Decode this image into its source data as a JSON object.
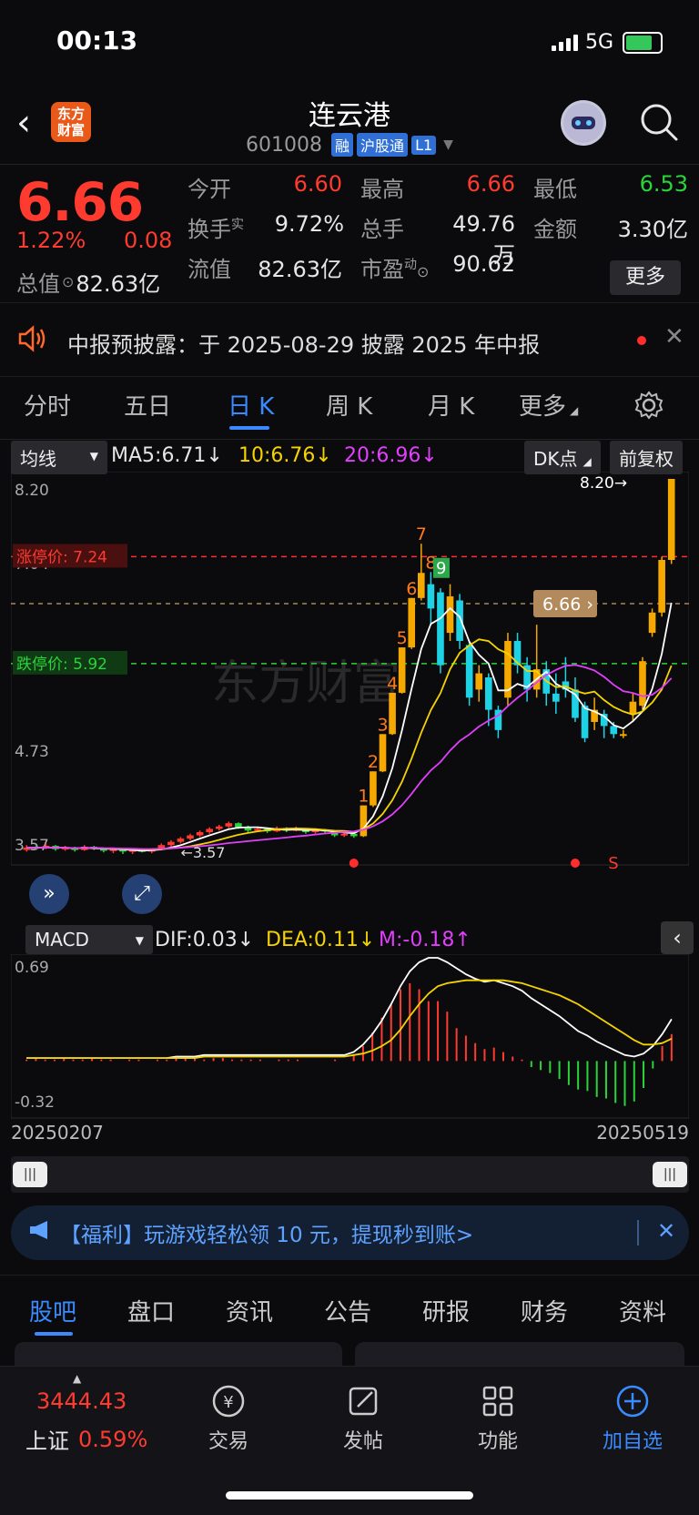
{
  "status_bar": {
    "time": "00:13",
    "network": "5G"
  },
  "header": {
    "logo_text": "东方财富",
    "title": "连云港",
    "code": "601008",
    "tags": [
      "融",
      "沪股通",
      "L1"
    ]
  },
  "quote": {
    "price": "6.66",
    "change_pct": "1.22%",
    "change_amt": "0.08",
    "rows": [
      [
        {
          "label": "今开",
          "value": "6.60",
          "color": "red"
        },
        {
          "label": "最高",
          "value": "6.66",
          "color": "red"
        },
        {
          "label": "最低",
          "value": "6.53",
          "color": "green"
        }
      ],
      [
        {
          "label": "换手",
          "sup": "实",
          "value": "9.72%",
          "color": "white"
        },
        {
          "label": "总手",
          "value": "49.76万",
          "color": "white"
        },
        {
          "label": "金额",
          "value": "3.30亿",
          "color": "white"
        }
      ],
      [
        {
          "label": "流值",
          "value": "82.63亿",
          "color": "white"
        },
        {
          "label": "市盈",
          "sup": "动",
          "value": "90.62",
          "color": "white"
        }
      ]
    ],
    "total_value_label": "总值",
    "total_value": "82.63亿",
    "more_label": "更多"
  },
  "notice": {
    "text": "中报预披露：于 2025-08-29 披露 2025 年中报"
  },
  "tabs": [
    "分时",
    "五日",
    "日 K",
    "周 K",
    "月 K",
    "更多"
  ],
  "active_tab": 2,
  "ma": {
    "dropdown": "均线",
    "ma5": "MA5:6.71",
    "ma10": "10:6.76",
    "ma20": "20:6.96",
    "dk_label": "DK点",
    "adjust_label": "前复权"
  },
  "macd": {
    "dropdown": "MACD",
    "dif": "DIF:0.03",
    "dea": "DEA:0.11",
    "m": "M:-0.18"
  },
  "colors": {
    "up": "#ff3b30",
    "down": "#2ad43a",
    "accent": "#3a8bff",
    "ma5": "#ffffff",
    "ma10": "#f5d300",
    "ma20": "#e040fb"
  },
  "chart_data": [
    {
      "type": "candlestick",
      "ylim": [
        3.57,
        8.2
      ],
      "y_ticks": [
        "8.20",
        "7.04",
        "5.89",
        "4.73",
        "3.57"
      ],
      "limit_up_label": "涨停价:",
      "limit_up": "7.24",
      "limit_down_label": "跌停价:",
      "limit_down": "5.92",
      "current_label": "6.66",
      "high_label": "8.20",
      "low_label": "3.57",
      "signal_labels": [
        "1",
        "2",
        "3",
        "4",
        "5",
        "6",
        "7",
        "8",
        "9",
        "S"
      ],
      "watermark": "东方财富",
      "candles": [
        {
          "o": 3.62,
          "c": 3.65,
          "h": 3.68,
          "l": 3.6
        },
        {
          "o": 3.66,
          "c": 3.64,
          "h": 3.68,
          "l": 3.62
        },
        {
          "o": 3.64,
          "c": 3.67,
          "h": 3.7,
          "l": 3.63
        },
        {
          "o": 3.67,
          "c": 3.63,
          "h": 3.68,
          "l": 3.61
        },
        {
          "o": 3.63,
          "c": 3.65,
          "h": 3.67,
          "l": 3.61
        },
        {
          "o": 3.65,
          "c": 3.62,
          "h": 3.66,
          "l": 3.6
        },
        {
          "o": 3.62,
          "c": 3.66,
          "h": 3.68,
          "l": 3.61
        },
        {
          "o": 3.66,
          "c": 3.64,
          "h": 3.67,
          "l": 3.62
        },
        {
          "o": 3.64,
          "c": 3.61,
          "h": 3.65,
          "l": 3.59
        },
        {
          "o": 3.61,
          "c": 3.63,
          "h": 3.65,
          "l": 3.58
        },
        {
          "o": 3.63,
          "c": 3.6,
          "h": 3.64,
          "l": 3.57
        },
        {
          "o": 3.6,
          "c": 3.62,
          "h": 3.63,
          "l": 3.57
        },
        {
          "o": 3.62,
          "c": 3.6,
          "h": 3.64,
          "l": 3.59
        },
        {
          "o": 3.6,
          "c": 3.63,
          "h": 3.64,
          "l": 3.58
        },
        {
          "o": 3.63,
          "c": 3.68,
          "h": 3.7,
          "l": 3.62
        },
        {
          "o": 3.68,
          "c": 3.72,
          "h": 3.74,
          "l": 3.66
        },
        {
          "o": 3.72,
          "c": 3.76,
          "h": 3.78,
          "l": 3.7
        },
        {
          "o": 3.76,
          "c": 3.8,
          "h": 3.82,
          "l": 3.74
        },
        {
          "o": 3.8,
          "c": 3.84,
          "h": 3.86,
          "l": 3.78
        },
        {
          "o": 3.84,
          "c": 3.88,
          "h": 3.9,
          "l": 3.82
        },
        {
          "o": 3.88,
          "c": 3.91,
          "h": 3.93,
          "l": 3.86
        },
        {
          "o": 3.91,
          "c": 3.95,
          "h": 3.97,
          "l": 3.89
        },
        {
          "o": 3.95,
          "c": 3.9,
          "h": 3.96,
          "l": 3.88
        },
        {
          "o": 3.9,
          "c": 3.86,
          "h": 3.92,
          "l": 3.84
        },
        {
          "o": 3.86,
          "c": 3.88,
          "h": 3.9,
          "l": 3.84
        },
        {
          "o": 3.88,
          "c": 3.85,
          "h": 3.89,
          "l": 3.83
        },
        {
          "o": 3.85,
          "c": 3.89,
          "h": 3.91,
          "l": 3.84
        },
        {
          "o": 3.89,
          "c": 3.86,
          "h": 3.9,
          "l": 3.84
        },
        {
          "o": 3.86,
          "c": 3.88,
          "h": 3.91,
          "l": 3.85
        },
        {
          "o": 3.88,
          "c": 3.84,
          "h": 3.89,
          "l": 3.82
        },
        {
          "o": 3.84,
          "c": 3.87,
          "h": 3.89,
          "l": 3.82
        },
        {
          "o": 3.87,
          "c": 3.85,
          "h": 3.88,
          "l": 3.83
        },
        {
          "o": 3.85,
          "c": 3.8,
          "h": 3.86,
          "l": 3.78
        },
        {
          "o": 3.8,
          "c": 3.82,
          "h": 3.84,
          "l": 3.78
        },
        {
          "o": 3.82,
          "c": 3.79,
          "h": 3.83,
          "l": 3.77
        },
        {
          "o": 3.79,
          "c": 4.17,
          "h": 4.17,
          "l": 3.78
        },
        {
          "o": 4.17,
          "c": 4.59,
          "h": 4.59,
          "l": 4.15
        },
        {
          "o": 4.59,
          "c": 5.05,
          "h": 5.05,
          "l": 4.58
        },
        {
          "o": 5.05,
          "c": 5.56,
          "h": 5.56,
          "l": 5.04
        },
        {
          "o": 5.56,
          "c": 6.12,
          "h": 6.12,
          "l": 5.55
        },
        {
          "o": 6.12,
          "c": 6.73,
          "h": 6.73,
          "l": 6.1
        },
        {
          "o": 6.73,
          "c": 7.04,
          "h": 7.4,
          "l": 6.7
        },
        {
          "o": 6.9,
          "c": 6.6,
          "h": 7.05,
          "l": 6.4
        },
        {
          "o": 6.8,
          "c": 5.9,
          "h": 6.85,
          "l": 5.8
        },
        {
          "o": 6.3,
          "c": 6.75,
          "h": 6.9,
          "l": 6.2
        },
        {
          "o": 6.7,
          "c": 6.2,
          "h": 6.78,
          "l": 6.1
        },
        {
          "o": 6.15,
          "c": 5.5,
          "h": 6.2,
          "l": 5.4
        },
        {
          "o": 5.6,
          "c": 5.8,
          "h": 5.9,
          "l": 5.45
        },
        {
          "o": 5.75,
          "c": 5.35,
          "h": 5.8,
          "l": 5.15
        },
        {
          "o": 5.35,
          "c": 5.1,
          "h": 5.4,
          "l": 5.0
        },
        {
          "o": 5.5,
          "c": 6.2,
          "h": 6.3,
          "l": 5.4
        },
        {
          "o": 6.2,
          "c": 5.9,
          "h": 6.3,
          "l": 5.8
        },
        {
          "o": 5.9,
          "c": 5.6,
          "h": 6.0,
          "l": 5.45
        },
        {
          "o": 5.6,
          "c": 5.85,
          "h": 6.4,
          "l": 5.5
        },
        {
          "o": 5.85,
          "c": 5.55,
          "h": 5.95,
          "l": 5.4
        },
        {
          "o": 5.55,
          "c": 5.45,
          "h": 5.8,
          "l": 5.3
        },
        {
          "o": 5.7,
          "c": 5.6,
          "h": 6.0,
          "l": 5.5
        },
        {
          "o": 5.6,
          "c": 5.25,
          "h": 5.75,
          "l": 5.2
        },
        {
          "o": 5.4,
          "c": 5.0,
          "h": 5.45,
          "l": 4.95
        },
        {
          "o": 5.2,
          "c": 5.35,
          "h": 5.5,
          "l": 5.1
        },
        {
          "o": 5.3,
          "c": 5.15,
          "h": 5.35,
          "l": 5.0
        },
        {
          "o": 5.15,
          "c": 5.05,
          "h": 5.2,
          "l": 5.0
        },
        {
          "o": 5.05,
          "c": 5.05,
          "h": 5.1,
          "l": 5.0
        },
        {
          "o": 5.3,
          "c": 5.45,
          "h": 5.55,
          "l": 5.2
        },
        {
          "o": 5.4,
          "c": 5.95,
          "h": 6.0,
          "l": 5.35
        },
        {
          "o": 6.3,
          "c": 6.55,
          "h": 6.6,
          "l": 6.25
        },
        {
          "o": 6.55,
          "c": 7.2,
          "h": 7.24,
          "l": 6.5
        },
        {
          "o": 7.2,
          "c": 8.2,
          "h": 8.2,
          "l": 7.15
        }
      ]
    },
    {
      "type": "macd",
      "ylim": [
        -0.32,
        0.69
      ],
      "y_ticks": [
        "0.69",
        "-0.32"
      ],
      "x_range": [
        "20250207",
        "20250519"
      ],
      "histogram": [
        0.01,
        0.02,
        0.01,
        0.01,
        0.02,
        0.01,
        0.01,
        0.02,
        0.01,
        0.01,
        0.0,
        0.01,
        0.01,
        0.0,
        0.01,
        0.01,
        0.02,
        0.02,
        0.02,
        0.01,
        0.02,
        0.02,
        0.01,
        0.01,
        0.01,
        0.01,
        0.0,
        0.01,
        0.01,
        0.01,
        0.0,
        0.0,
        0.0,
        0.01,
        0.0,
        0.04,
        0.1,
        0.19,
        0.29,
        0.38,
        0.48,
        0.52,
        0.48,
        0.4,
        0.4,
        0.33,
        0.22,
        0.17,
        0.12,
        0.08,
        0.09,
        0.06,
        0.03,
        0.01,
        -0.04,
        -0.06,
        -0.08,
        -0.12,
        -0.16,
        -0.19,
        -0.2,
        -0.24,
        -0.25,
        -0.28,
        -0.3,
        -0.27,
        -0.18,
        -0.05,
        0.1,
        0.18
      ],
      "dif": [
        0.02,
        0.02,
        0.02,
        0.02,
        0.02,
        0.02,
        0.02,
        0.02,
        0.02,
        0.02,
        0.02,
        0.02,
        0.02,
        0.02,
        0.02,
        0.02,
        0.03,
        0.03,
        0.03,
        0.04,
        0.04,
        0.04,
        0.04,
        0.04,
        0.04,
        0.04,
        0.04,
        0.04,
        0.04,
        0.04,
        0.04,
        0.04,
        0.04,
        0.04,
        0.04,
        0.06,
        0.11,
        0.18,
        0.27,
        0.38,
        0.5,
        0.6,
        0.66,
        0.69,
        0.69,
        0.66,
        0.62,
        0.58,
        0.55,
        0.53,
        0.54,
        0.52,
        0.5,
        0.47,
        0.42,
        0.38,
        0.34,
        0.3,
        0.25,
        0.2,
        0.17,
        0.13,
        0.1,
        0.07,
        0.04,
        0.03,
        0.05,
        0.1,
        0.18,
        0.28
      ],
      "dea": [
        0.02,
        0.02,
        0.02,
        0.02,
        0.02,
        0.02,
        0.02,
        0.02,
        0.02,
        0.02,
        0.02,
        0.02,
        0.02,
        0.02,
        0.02,
        0.02,
        0.02,
        0.02,
        0.02,
        0.03,
        0.03,
        0.03,
        0.03,
        0.03,
        0.03,
        0.03,
        0.03,
        0.03,
        0.03,
        0.03,
        0.03,
        0.03,
        0.03,
        0.03,
        0.03,
        0.04,
        0.05,
        0.07,
        0.1,
        0.14,
        0.21,
        0.3,
        0.38,
        0.45,
        0.5,
        0.52,
        0.53,
        0.54,
        0.54,
        0.54,
        0.54,
        0.54,
        0.53,
        0.52,
        0.5,
        0.48,
        0.46,
        0.44,
        0.41,
        0.38,
        0.34,
        0.3,
        0.26,
        0.22,
        0.18,
        0.14,
        0.11,
        0.11,
        0.12,
        0.15
      ]
    }
  ],
  "ad": {
    "text": "【福利】玩游戏轻松领 10 元，提现秒到账>"
  },
  "bottom_tabs": [
    "股吧",
    "盘口",
    "资讯",
    "公告",
    "研报",
    "财务",
    "资料"
  ],
  "footer": {
    "index_value": "3444.43",
    "index_name": "上证",
    "index_pct": "0.59%",
    "items": [
      {
        "label": "交易",
        "icon": "yen-circle-icon"
      },
      {
        "label": "发帖",
        "icon": "edit-icon"
      },
      {
        "label": "功能",
        "icon": "grid-icon"
      },
      {
        "label": "加自选",
        "icon": "plus-circle-icon"
      }
    ]
  }
}
